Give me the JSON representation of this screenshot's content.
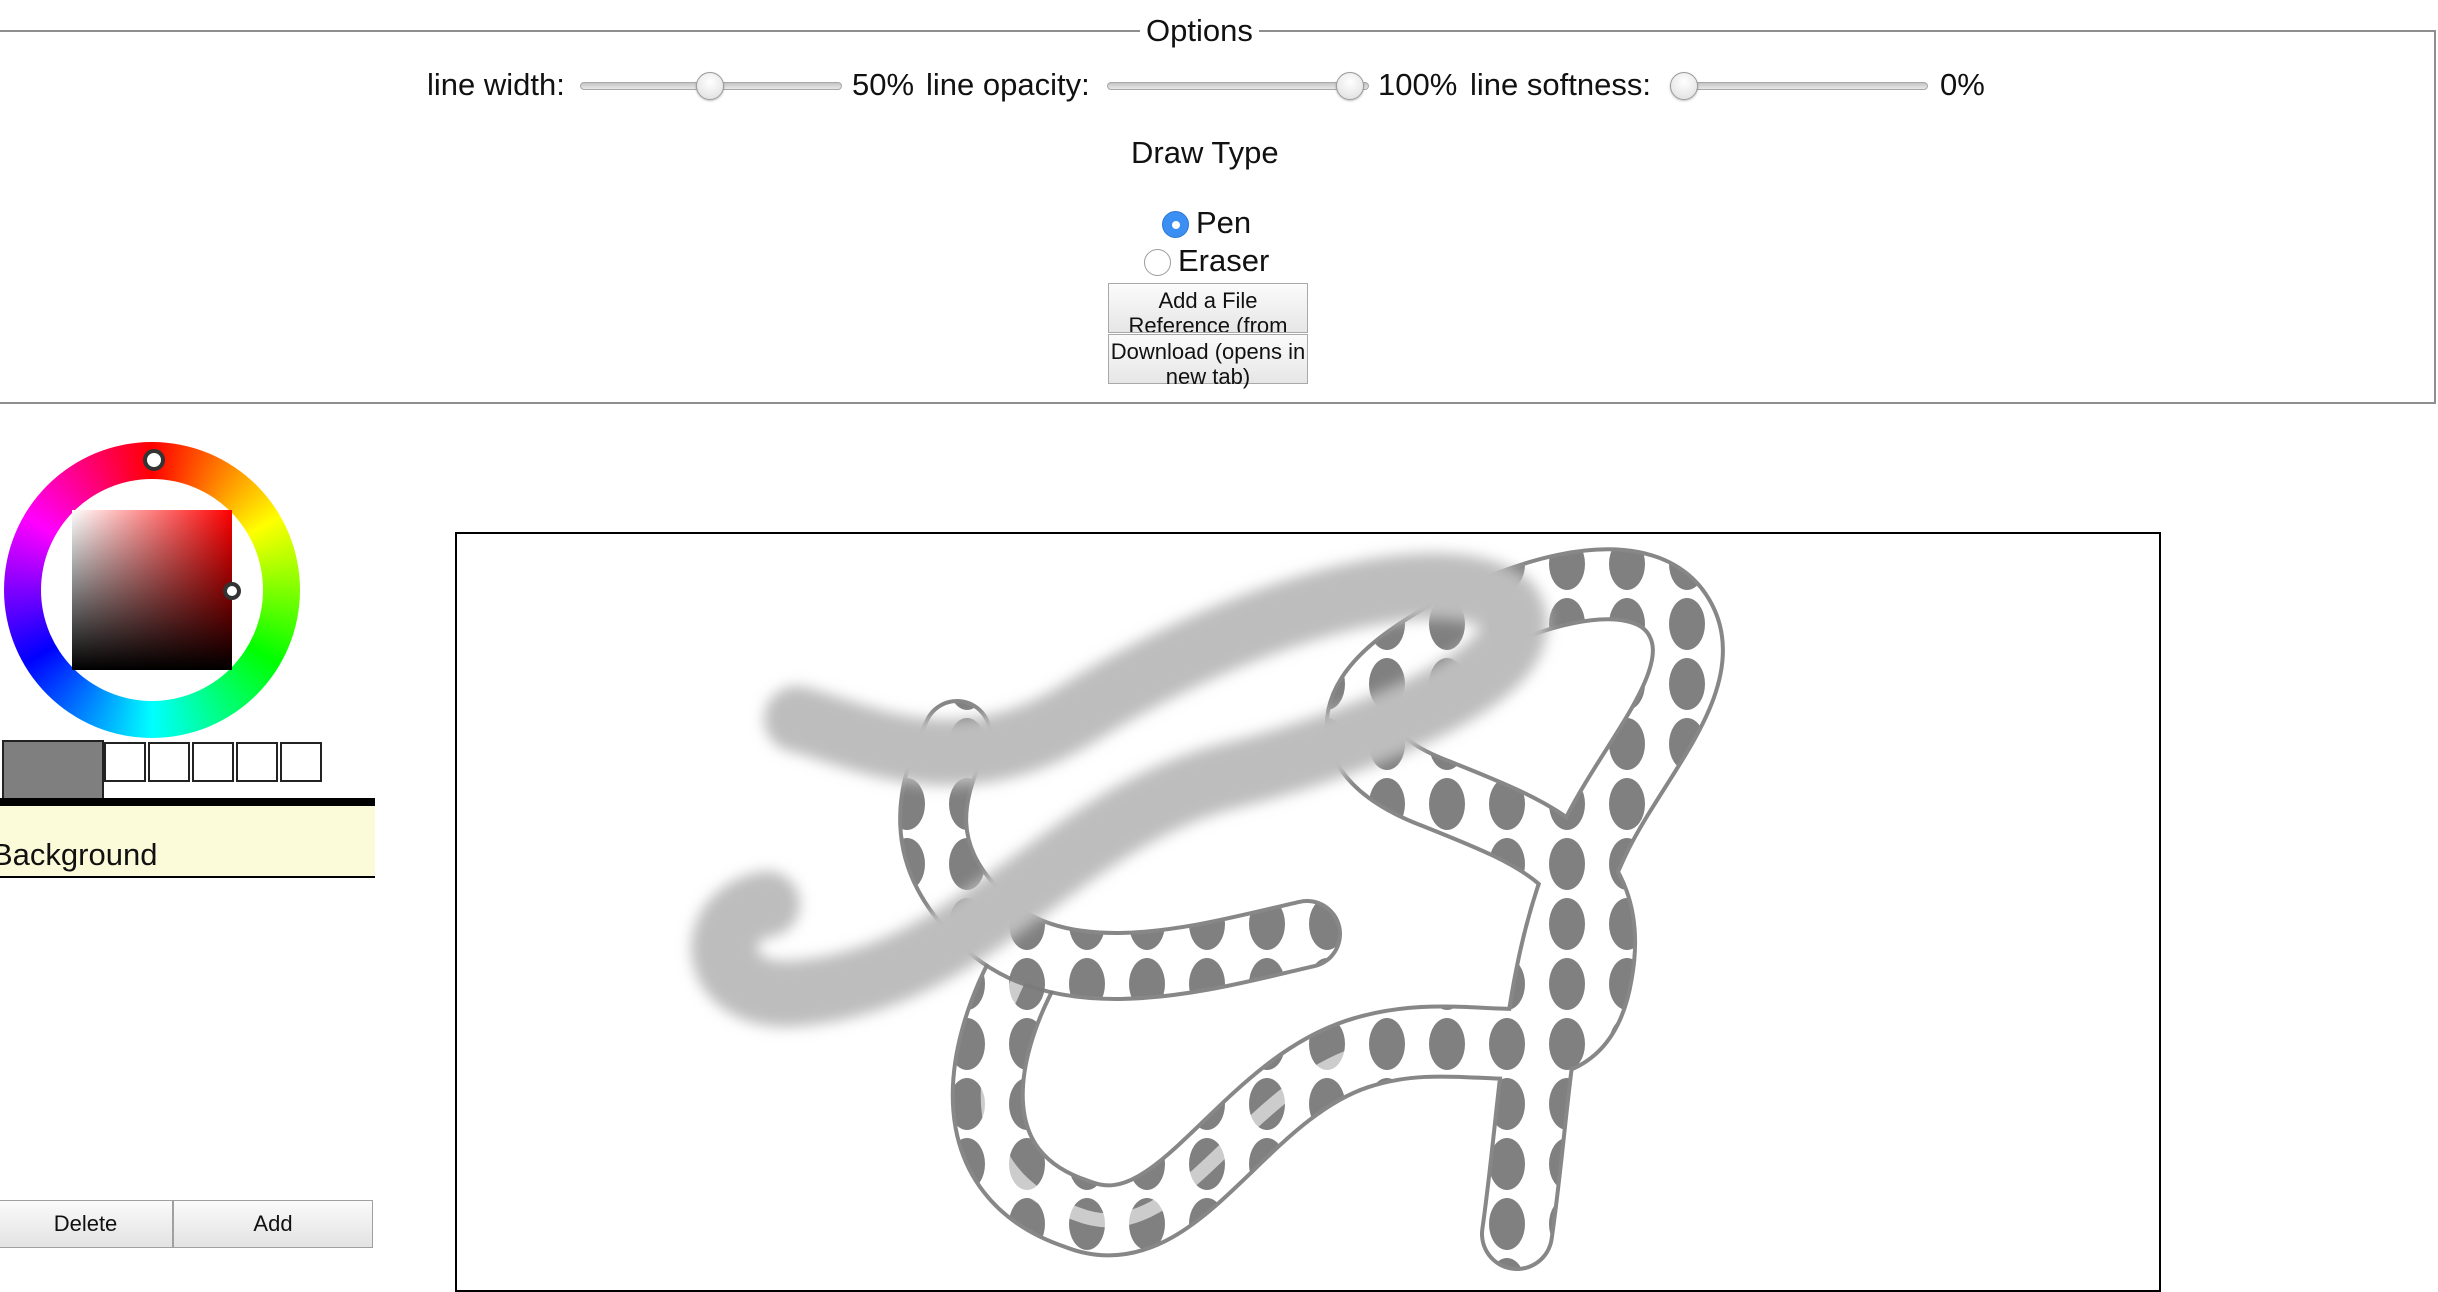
{
  "options": {
    "legend": "Options",
    "sliders": [
      {
        "label": "line width:",
        "value": 50,
        "value_text": "50%"
      },
      {
        "label": "line opacity:",
        "value": 100,
        "value_text": "100%"
      },
      {
        "label": "line softness:",
        "value": 0,
        "value_text": "0%"
      }
    ],
    "draw_type": {
      "heading": "Draw Type",
      "options": [
        {
          "label": "Pen",
          "selected": true
        },
        {
          "label": "Eraser",
          "selected": false
        }
      ]
    },
    "buttons": {
      "add_reference": "Add a File Reference (from",
      "download": "Download (opens in new tab)"
    }
  },
  "color_picker": {
    "current_color": "#7f7f7f",
    "hue_color": "#ff0000",
    "swatch_slots": 5
  },
  "layers": {
    "items": [
      {
        "name": "Background",
        "active": true
      }
    ],
    "delete_label": "Delete",
    "add_label": "Add"
  },
  "colors": {
    "accent": "#3b8ef2",
    "stroke_gray": "#808080",
    "soft_stroke": "#bdbdbd",
    "layer_highlight": "#fbfbd9"
  }
}
